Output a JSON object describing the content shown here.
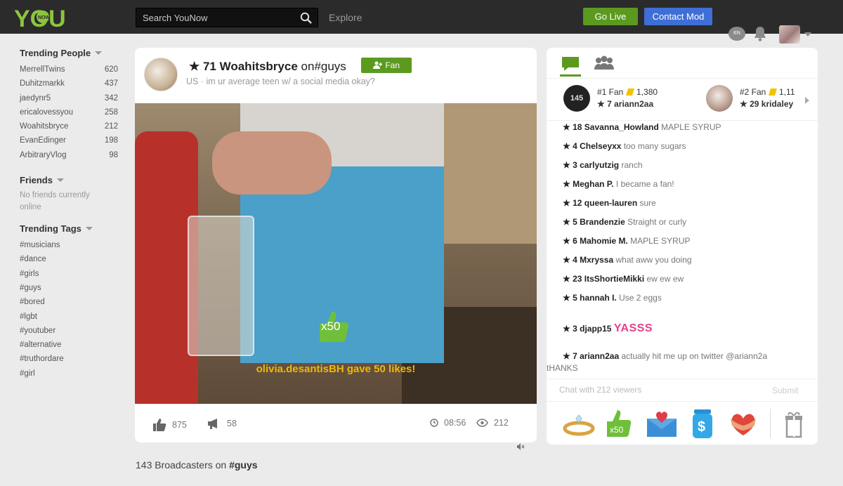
{
  "header": {
    "logo_text": "YOU",
    "logo_sub": "NOW",
    "search_placeholder": "Search YouNow",
    "explore": "Explore",
    "go_live": "Go Live",
    "contact_mod": "Contact Mod",
    "lang": "EN"
  },
  "sidebar": {
    "trending_people_title": "Trending People",
    "trending_people": [
      {
        "name": "MerrellTwins",
        "count": "620"
      },
      {
        "name": "Duhitzmarkk",
        "count": "437"
      },
      {
        "name": "jaedynr5",
        "count": "342"
      },
      {
        "name": "ericalovessyou",
        "count": "258"
      },
      {
        "name": "Woahitsbryce",
        "count": "212"
      },
      {
        "name": "EvanEdinger",
        "count": "198"
      },
      {
        "name": "ArbitraryVlog",
        "count": "98"
      }
    ],
    "friends_title": "Friends",
    "friends_empty": "No friends currently online",
    "trending_tags_title": "Trending Tags",
    "tags": [
      "#musicians",
      "#dance",
      "#girls",
      "#guys",
      "#bored",
      "#lgbt",
      "#youtuber",
      "#alternative",
      "#truthordare",
      "#girl"
    ]
  },
  "broadcast": {
    "star_level": "★ 71",
    "name": "Woahitsbryce",
    "on_text": "on",
    "tag": "#guys",
    "fan_button": "Fan",
    "subtitle": "US · im ur average teen w/ a social media okay?",
    "like_badge": "x50",
    "gave_text": "olivia.desantisBH gave 50 likes!",
    "likes": "875",
    "shares": "58",
    "time": "08:56",
    "viewers": "212"
  },
  "chat": {
    "fans": [
      {
        "rank": "#1 Fan",
        "points": "1,380",
        "star_level": "★ 7",
        "user": "ariann2aa",
        "avatar_text": "145"
      },
      {
        "rank": "#2 Fan",
        "points": "1,11",
        "star_level": "★ 29",
        "user": "kridaley",
        "avatar_text": ""
      }
    ],
    "messages": [
      {
        "level": "★ 18",
        "user": "Savanna_Howland",
        "text": "MAPLE SYRUP"
      },
      {
        "level": "★ 4",
        "user": "Chelseyxx",
        "text": "too many sugars"
      },
      {
        "level": "★ 3",
        "user": "carlyutzig",
        "text": "ranch"
      },
      {
        "level": "★",
        "user": "Meghan P.",
        "text": "I became a fan!"
      },
      {
        "level": "★ 12",
        "user": "queen-lauren",
        "text": "sure"
      },
      {
        "level": "★ 5",
        "user": "Brandenzie",
        "text": "Straight or curly"
      },
      {
        "level": "★ 6",
        "user": "Mahomie M.",
        "text": "MAPLE SYRUP"
      },
      {
        "level": "★ 4",
        "user": "Mxryssa",
        "text": "what aww you doing"
      },
      {
        "level": "★ 23",
        "user": "ItsShortieMikki",
        "text": "ew ew ew"
      },
      {
        "level": "★ 5",
        "user": "hannah I.",
        "text": "Use 2 eggs"
      },
      {
        "level": "★ 3",
        "user": "djapp15",
        "text": "YASSS"
      },
      {
        "level": "★ 7",
        "user": "ariann2aa",
        "text": "actually hit me up on twitter @ariann2a",
        "text2": "tHANKS"
      }
    ],
    "input_placeholder": "Chat with 212 viewers",
    "submit": "Submit",
    "gift_like_badge": "x50"
  },
  "footer": {
    "count_text": "143 Broadcasters on",
    "tag": "#guys"
  },
  "colors": {
    "green": "#5b9a1f",
    "blue": "#3f6fd6",
    "gold": "#f2b705",
    "pink": "#e8408b"
  }
}
